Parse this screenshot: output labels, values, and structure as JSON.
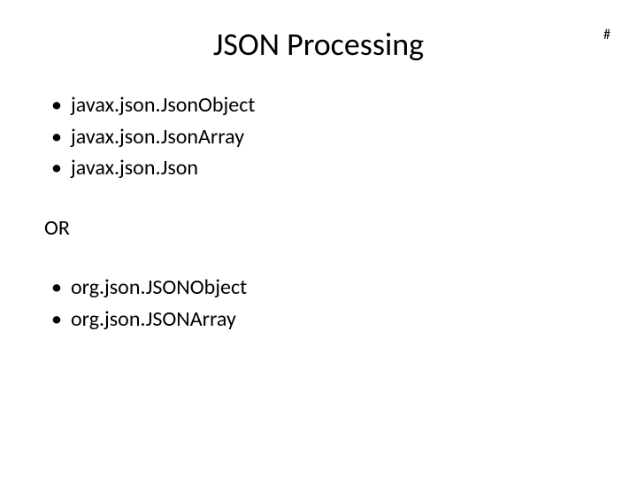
{
  "slide": {
    "title": "JSON Processing",
    "hash_marker": "#",
    "first_list": {
      "items": [
        "javax.json.JsonObject",
        "javax.json.JsonArray",
        "javax.json.Json"
      ]
    },
    "separator": "OR",
    "second_list": {
      "items": [
        "org.json.JSONObject",
        "org.json.JSONArray"
      ]
    }
  }
}
